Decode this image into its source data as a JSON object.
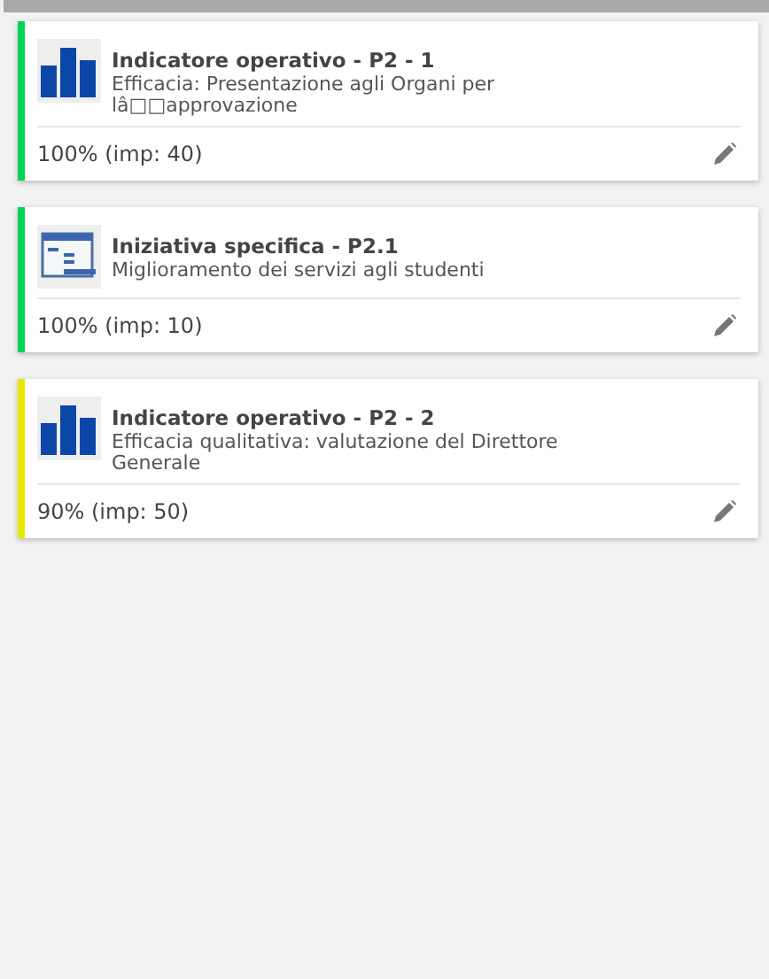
{
  "cards": [
    {
      "kind": "indicator",
      "color": "#00d455",
      "title": "Indicatore operativo - P2 - 1",
      "description": "Efficacia: Presentazione agli Organi per lâ□□approvazione",
      "progress": "100% (imp: 40)"
    },
    {
      "kind": "initiative",
      "color": "#00d455",
      "title": "Iniziativa specifica - P2.1",
      "description": "Miglioramento dei servizi agli studenti",
      "progress": "100% (imp: 10)"
    },
    {
      "kind": "indicator",
      "color": "#e8e800",
      "title": "Indicatore operativo - P2 - 2",
      "description": "Efficacia qualitativa: valutazione del Direttore Generale",
      "progress": "90% (imp: 50)"
    }
  ]
}
